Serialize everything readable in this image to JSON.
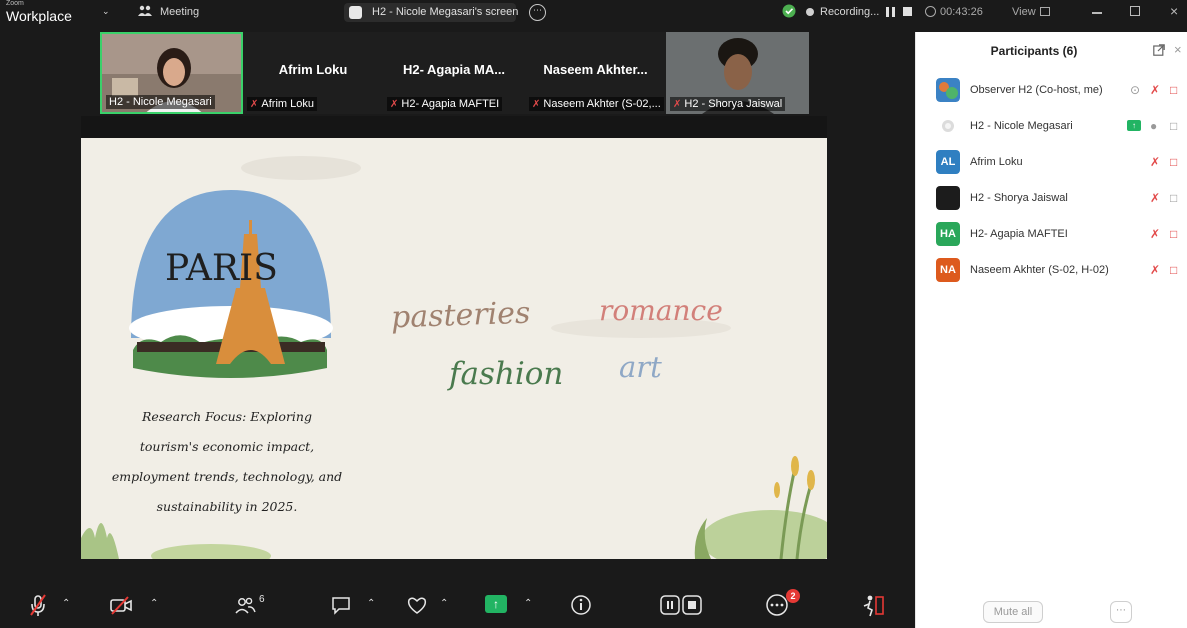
{
  "topbar": {
    "app_name": "Workplace",
    "app_name_top": "Zoom",
    "meeting_label": "Meeting",
    "share_label": "H2 - Nicole Megasari's screen",
    "recording_label": "Recording...",
    "timer": "00:43:26",
    "view_label": "View"
  },
  "video_strip": [
    {
      "name": "",
      "label": "H2 - Nicole Megasari",
      "muted": false
    },
    {
      "name": "Afrim Loku",
      "label": "Afrim Loku",
      "muted": true
    },
    {
      "name": "H2- Agapia MA...",
      "label": "H2- Agapia MAFTEI",
      "muted": true
    },
    {
      "name": "Naseem Akhter...",
      "label": "Naseem Akhter (S-02,...",
      "muted": true
    },
    {
      "name": "",
      "label": "H2 - Shorya Jaiswal",
      "muted": true
    }
  ],
  "slide": {
    "logo_text": "PARIS",
    "words": {
      "w1": "pasteries",
      "w2": "romance",
      "w3": "fashion",
      "w4": "art"
    },
    "research_lines": [
      "Research Focus: Exploring",
      "tourism's economic impact,",
      "employment trends, technology, and",
      "sustainability in 2025."
    ],
    "colors": {
      "background": "#f1eee6",
      "sky": "#7fa8d2",
      "tower": "#d98e3c",
      "bush": "#4e8a4a"
    }
  },
  "participants": {
    "title": "Participants (6)",
    "rows": [
      {
        "initials": "",
        "name": "Observer H2 (Co-host, me)",
        "color": "#3b82c4"
      },
      {
        "initials": "",
        "name": "H2 - Nicole Megasari",
        "color": "#e8e8e8"
      },
      {
        "initials": "AL",
        "name": "Afrim Loku",
        "color": "#2f7fc1"
      },
      {
        "initials": "",
        "name": "H2 - Shorya Jaiswal",
        "color": "#1c1c1c"
      },
      {
        "initials": "HA",
        "name": "H2- Agapia MAFTEI",
        "color": "#2aa75a"
      },
      {
        "initials": "NA",
        "name": "Naseem Akhter (S-02, H-02)",
        "color": "#dd5a1d"
      }
    ],
    "mute_all_label": "Mute all"
  },
  "toolbar": {
    "participants_count": "6",
    "more_badge": "2"
  }
}
